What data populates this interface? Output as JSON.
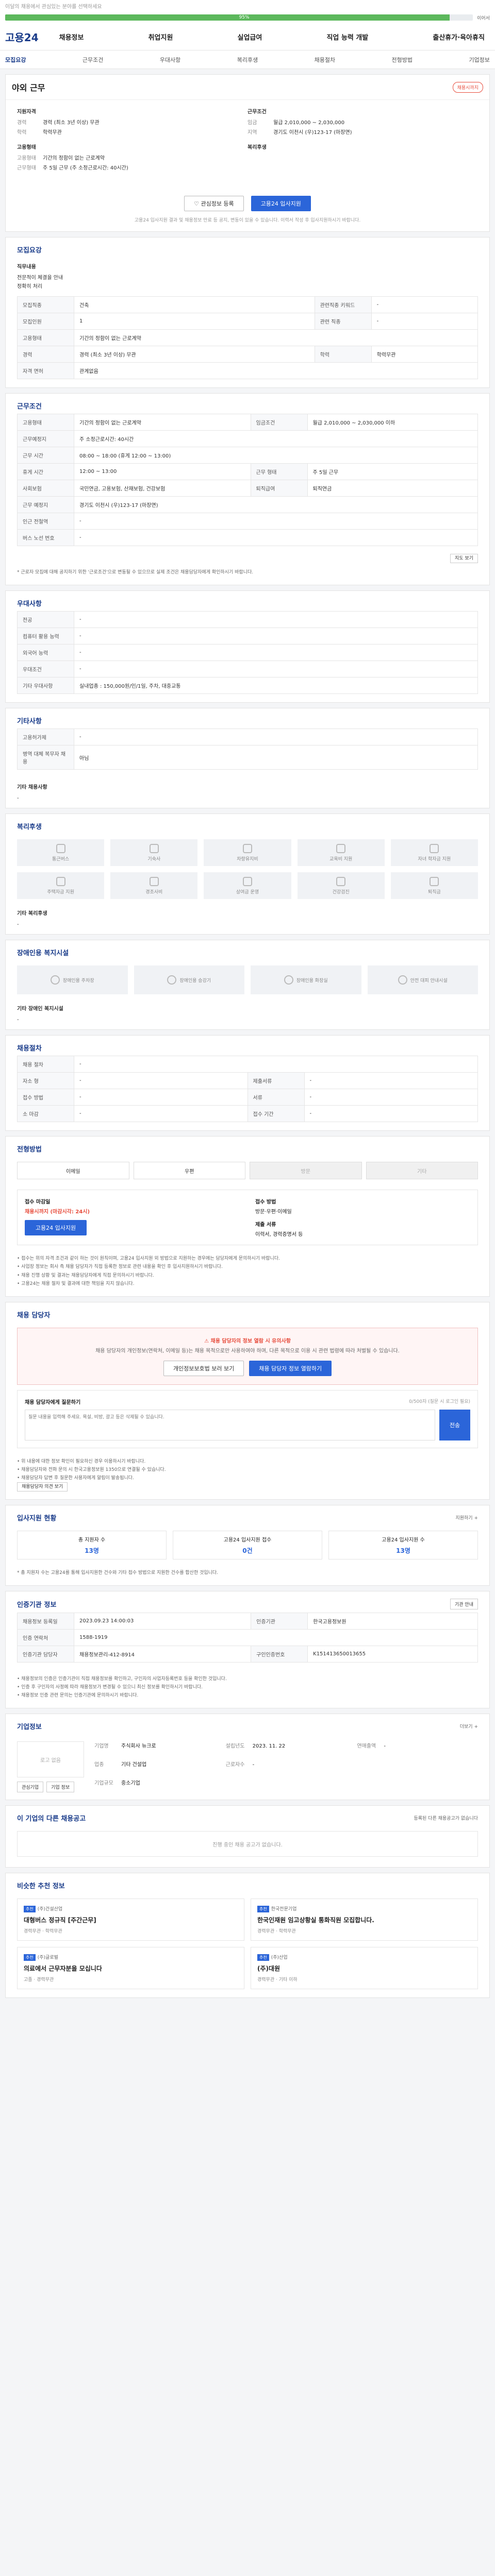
{
  "topbar": {
    "text": "이달의 채용에서 관심있는 분야를 선택하세요"
  },
  "progress": {
    "pct_value": 0.95,
    "label": "95%",
    "right": "이어서"
  },
  "header": {
    "logo": "고용24",
    "gnb": [
      "채용정보",
      "취업지원",
      "실업급여",
      "직업 능력 개발",
      "출산휴가·육아휴직"
    ]
  },
  "subnav": {
    "items": [
      "모집요강",
      "근무조건",
      "우대사항",
      "복리후생",
      "채용절차",
      "전형방법",
      "기업정보"
    ]
  },
  "job": {
    "title": "야외 근무",
    "badge": "채용시까지",
    "summary_left_title": "지원자격",
    "summary_left": [
      {
        "k": "경력",
        "v": "경력 (최소 3년 이상) 무관"
      },
      {
        "k": "학력",
        "v": "학력무관"
      }
    ],
    "summary_right_title": "근무조건",
    "summary_right": [
      {
        "k": "임금",
        "v": "월급 2,010,000 ~ 2,030,000"
      },
      {
        "k": "지역",
        "v": "경기도 이천시 (우)123-17 (마장면)"
      }
    ],
    "type_title": "고용형태",
    "type_rows": [
      {
        "k": "고용형태",
        "v": "기간의 정함이 없는 근로계약"
      },
      {
        "k": "근무형태",
        "v": "주 5일 근무 (주 소정근로시간: 40시간)"
      }
    ],
    "welfare_title": "복리후생",
    "btn_save": "관심정보 등록",
    "btn_apply": "고용24 입사지원",
    "note": "고용24 입사지원 결과 및 채용정보 만료 등 공지, 변동이 있을 수 있습니다. 이력서 작성 후 입사지원하시기 바랍니다."
  },
  "recruit": {
    "title": "모집요강",
    "desc_title": "직무내용",
    "desc_lines": [
      "전문적이 체결을 안내",
      "정확히 처리"
    ],
    "rows": [
      [
        {
          "k": "모집직종",
          "v": "건축"
        },
        {
          "k": "관련직종 키워드",
          "v": "-"
        }
      ],
      [
        {
          "k": "모집인원",
          "v": "1"
        },
        {
          "k": "관련 직종",
          "v": "-"
        }
      ],
      [
        {
          "k": "고용형태",
          "v": "기간의 정함이 없는 근로계약"
        },
        {
          "k": "",
          "v": ""
        }
      ],
      [
        {
          "k": "경력",
          "v": "경력 (최소 3년 이상) 무관"
        },
        {
          "k": "학력",
          "v": "학력무관"
        }
      ],
      [
        {
          "k": "자격 면허",
          "v": "관계없음"
        },
        {
          "k": "",
          "v": ""
        }
      ]
    ]
  },
  "conditions": {
    "title": "근무조건",
    "rows": [
      [
        {
          "k": "고용형태",
          "v": "기간의 정함이 없는 근로계약"
        },
        {
          "k": "임금조건",
          "v": "월급 2,010,000 ~ 2,030,000 이하"
        }
      ],
      [
        {
          "k": "근무예정지",
          "v": "주 소정근로시간: 40시간"
        },
        {
          "k": "",
          "v": ""
        }
      ],
      [
        {
          "k": "근무 시간",
          "v": "08:00 ~ 18:00 (휴게 12:00 ~ 13:00)"
        },
        {
          "k": "",
          "v": ""
        }
      ],
      [
        {
          "k": "휴게 시간",
          "v": "12:00 ~ 13:00"
        },
        {
          "k": "근무 형태",
          "v": "주 5일 근무"
        }
      ],
      [
        {
          "k": "사회보험",
          "v": "국민연금, 고용보험, 산재보험, 건강보험"
        },
        {
          "k": "퇴직급여",
          "v": "퇴직연금"
        }
      ],
      [
        {
          "k": "근무 예정지",
          "v": "경기도 이천시 (우)123-17 (마장면)"
        },
        {
          "k": "",
          "v": ""
        }
      ],
      [
        {
          "k": "인근 전철역",
          "v": "-"
        },
        {
          "k": "",
          "v": ""
        }
      ],
      [
        {
          "k": "버스 노선 번호",
          "v": "-"
        },
        {
          "k": "",
          "v": ""
        }
      ]
    ],
    "map_btn": "지도 보기",
    "footnote": "* 근로자 모집에 대해 공지하기 위한 '근로조건'으로 변동될 수 있으므로 실제 조건은 채용담당자에게 확인하시기 바랍니다."
  },
  "preference": {
    "title": "우대사항",
    "rows": [
      {
        "k": "전공",
        "v": "-"
      },
      {
        "k": "컴퓨터 활용 능력",
        "v": "-"
      },
      {
        "k": "외국어 능력",
        "v": "-"
      },
      {
        "k": "우대조건",
        "v": "-"
      },
      {
        "k": "기타 우대사항",
        "v": "실내업종 : 150,000원/인/1일, 주차, 대중교통"
      }
    ]
  },
  "etc": {
    "title": "기타사항",
    "rows": [
      {
        "k": "고용허가제",
        "v": "-"
      },
      {
        "k": "병역 대체 복무자 채용",
        "v": "아님"
      }
    ],
    "extra_title": "기타 채용사항",
    "extra_value": "-"
  },
  "welfare": {
    "title": "복리후생",
    "items": [
      "통근버스",
      "기숙사",
      "차량유지비",
      "교육비 지원",
      "자녀 학자금 지원",
      "주택자금 지원",
      "경조사비",
      "상여금 운영",
      "건강검진",
      "퇴직금"
    ],
    "other_title": "기타 복리후생",
    "other_value": "-"
  },
  "disability": {
    "title": "장애인용 복지시설",
    "items": [
      "장애인용 주차장",
      "장애인용 승강기",
      "장애인용 화장실",
      "안전 대피 안내시설"
    ],
    "other_title": "기타 장애인 복지시설",
    "other_value": "-"
  },
  "process": {
    "title": "채용절차",
    "rows": [
      [
        {
          "k": "채용 절차",
          "v": "-"
        },
        {
          "k": "",
          "v": ""
        }
      ],
      [
        {
          "k": "자소 형",
          "v": "-"
        },
        {
          "k": "제출서류",
          "v": "-"
        }
      ],
      [
        {
          "k": "접수 방법",
          "v": "-"
        },
        {
          "k": "서류",
          "v": "-"
        }
      ],
      [
        {
          "k": "소 마감",
          "v": "-"
        },
        {
          "k": "접수 기간",
          "v": "-"
        }
      ]
    ]
  },
  "method": {
    "title": "전형방법",
    "tabs": [
      {
        "label": "이메일",
        "on": true
      },
      {
        "label": "우편",
        "on": true
      },
      {
        "label": "방문",
        "on": false
      },
      {
        "label": "기타",
        "on": false
      }
    ],
    "apply_title": "접수 마감일",
    "apply_value": "채용시까지 (마감시각: 24시)",
    "apply_btn": "고용24 입사지원",
    "method_title": "접수 방법",
    "method_value": "방문·우편·이메일",
    "doc_title": "제출 서류",
    "doc_value": "이력서, 경력증명서 등",
    "bullets": [
      "• 접수는 위의 자격 조건과 같이 하는 것이 원칙이며, 고용24 입사지원 외 방법으로 지원하는 경우에는 담당자에게 문의하시기 바랍니다.",
      "• 사업장 정보는 회사 측 채용 담당자가 직접 등록한 정보로 관련 내용을 확인 후 입사지원하시기 바랍니다.",
      "• 채용 진행 상황 및 결과는 채용담당자에게 직접 문의하시기 바랍니다.",
      "• 고용24는 채용 절차 및 결과에 대한 책임을 지지 않습니다."
    ]
  },
  "contact": {
    "title": "채용 담당자",
    "alert_title": "채용 담당자의 정보 열람 시 유의사항",
    "alert_desc": "채용 담당자의 개인정보(연락처, 이메일 등)는 채용 목적으로만 사용하여야 하며, 다른 목적으로 이용 시 관련 법령에 따라 처벌될 수 있습니다.",
    "btn_left": "개인정보보호법 보러 보기",
    "btn_right": "채용 담당자 정보 열람하기",
    "qa_title": "채용 담당자에게 질문하기",
    "qa_right": "0/500자 (질문 시 로그인 필요)",
    "qa_placeholder": "질문 내용을 입력해 주세요. 욕설, 비방, 광고 등은 삭제될 수 있습니다.",
    "qa_send": "전송",
    "bullets": [
      "• 위 내용에 대한 정보 확인이 필요하신 경우 이용하시기 바랍니다.",
      "• 채용담당자와 전화 문의 시 한국고용정보원 1350으로 연결될 수 있습니다.",
      "• 채용담당자 답변 후 질문한 사용자에게 알림이 발송됩니다."
    ],
    "bullet_btn": "채용담당자 의견 보기"
  },
  "stats": {
    "title": "입사지원 현황",
    "more": "지원하기 +",
    "items": [
      {
        "label": "총 지원자 수",
        "value": "13명"
      },
      {
        "label": "고용24 입사지원 접수",
        "value": "0건"
      },
      {
        "label": "고용24 입사지원 수",
        "value": "13명"
      }
    ],
    "footnote": "* 총 지원자 수는 고용24를 통해 입사지원한 건수와 기타 접수 방법으로 지원한 건수를 합산한 것입니다."
  },
  "info": {
    "title": "인증기관 정보",
    "btn": "기관 안내",
    "rows": [
      [
        {
          "k": "채용정보 등록일",
          "v": "2023.09.23 14:00:03"
        },
        {
          "k": "인증기관",
          "v": "한국고용정보원"
        }
      ],
      [
        {
          "k": "인증 연락처",
          "v": "1588-1919"
        },
        {
          "k": "",
          "v": ""
        }
      ],
      [
        {
          "k": "인증기관 담당자",
          "v": "채용정보관리-412-8914"
        },
        {
          "k": "구인인증번호",
          "v": "K151413650013655"
        }
      ]
    ],
    "bullets": [
      "• 채용정보의 인증은 인증기관이 직접 채용정보를 확인하고, 구인자의 사업자등록번호 등을 확인한 것입니다.",
      "• 인증 후 구인자의 사정에 따라 채용정보가 변경될 수 있으니 최신 정보를 확인하시기 바랍니다.",
      "• 채용정보 인증 관련 문의는 인증기관에 문의하시기 바랍니다."
    ]
  },
  "company": {
    "title": "기업정보",
    "more": "더보기 +",
    "logo_text": "로고 없음",
    "btn_a": "관심기업",
    "btn_b": "기업 정보",
    "fields": [
      {
        "k": "기업명",
        "v": "주식회사 뉴크로"
      },
      {
        "k": "설립년도",
        "v": "2023. 11. 22"
      },
      {
        "k": "연매출액",
        "v": "-"
      },
      {
        "k": "업종",
        "v": "기타 건설업"
      },
      {
        "k": "근로자수",
        "v": "-"
      },
      {
        "k": "",
        "v": ""
      },
      {
        "k": "기업규모",
        "v": "중소기업"
      },
      {
        "k": "",
        "v": ""
      },
      {
        "k": "",
        "v": ""
      }
    ]
  },
  "other_jobs": {
    "title": "이 기업의 다른 채용공고",
    "right": "등록된 다른 채용공고가 없습니다",
    "empty": "진행 중인 채용 공고가 없습니다."
  },
  "recommend": {
    "title": "비슷한 추천 정보",
    "items": [
      {
        "tag": "추천",
        "co": "(주)건설산업",
        "title": "대형버스 정규직 [주간근무]",
        "meta": "경력무관 · 학력무관"
      },
      {
        "tag": "추천",
        "co": "한국전문기업",
        "title": "한국인재원 임고상황실 통화직원 모집합니다.",
        "meta": "경력무관 · 학력무관"
      },
      {
        "tag": "추천",
        "co": "(주)글로벌",
        "title": "의료에서 근무자분을 모십니다",
        "meta": "고졸 · 경력무관"
      },
      {
        "tag": "추천",
        "co": "(주)산업",
        "title": "(주)대원",
        "meta": "경력무관 · 기타 이하"
      }
    ]
  }
}
